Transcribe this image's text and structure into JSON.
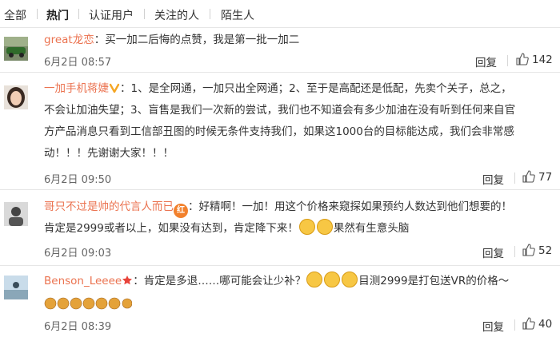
{
  "tabs": [
    {
      "label": "全部"
    },
    {
      "label": "热门"
    },
    {
      "label": "认证用户"
    },
    {
      "label": "关注的人"
    },
    {
      "label": "陌生人"
    }
  ],
  "comments": [
    {
      "user": "great龙恋",
      "lines": [
        "：买一加二后悔的点赞，我是第一批一加二"
      ],
      "time": "6月2日 08:57",
      "reply_label": "回复",
      "likes": "142"
    },
    {
      "user": "一加手机蒋婕",
      "lines": [
        "：1、是全网通，一加只出全网通；2、至于是高配还是低配，先卖个关子，总之，",
        "不会让加油失望；3、盲售是我们一次新的尝试，我们也不知道会有多少加油在没有听到任何来自官",
        "方产品消息只看到工信部丑图的时候无条件支持我们，如果这1000台的目标能达成，我们会非常感",
        "动！！！先谢谢大家！！！"
      ],
      "time": "6月2日 09:50",
      "reply_label": "回复",
      "likes": "77"
    },
    {
      "user": "哥只不过是帅的代言人而已",
      "lines": [
        "：好精啊！一加！用这个价格来窥探如果预约人数达到他们想要的！",
        "肯定是2999或者以上，如果没有达到，肯定降下来！",
        "果然有生意头脑"
      ],
      "time": "6月2日 09:03",
      "reply_label": "回复",
      "likes": "52"
    },
    {
      "user": "Benson_Leeee",
      "lines": [
        "：肯定是多退……哪可能会让少补？",
        "目测2999是打包送VR的价格～"
      ],
      "time": "6月2日 08:39",
      "reply_label": "回复",
      "likes": "40"
    }
  ],
  "colors": {
    "username": "#eb7350",
    "tab_active": "#222222",
    "divider": "#e6e6e6"
  }
}
